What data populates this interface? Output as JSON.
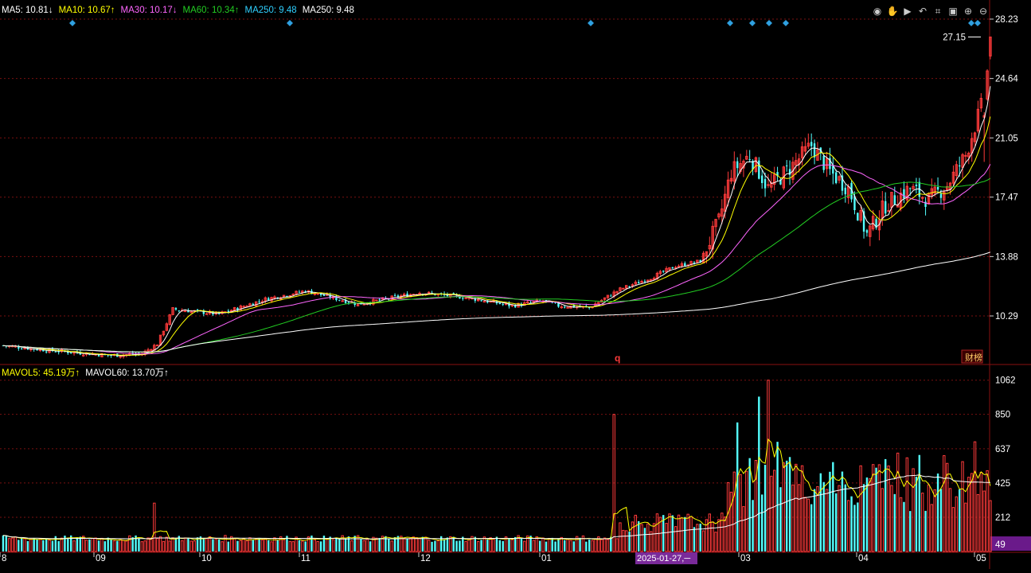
{
  "colors": {
    "up": "#ff3b3b",
    "down": "#54ffff",
    "grid": "#7a1010",
    "axis_text": "#ffffff",
    "ma5": "#ffffff",
    "ma10": "#ffff00",
    "ma30": "#ff66ff",
    "ma60": "#22cc22",
    "ma250": "#ffffff",
    "marker": "#2fa0e0"
  },
  "price_legend": [
    {
      "name": "MA5",
      "value": "10.81",
      "arrow": "↓",
      "color": "#ffffff"
    },
    {
      "name": "MA10",
      "value": "10.67",
      "arrow": "↑",
      "color": "#ffff00"
    },
    {
      "name": "MA30",
      "value": "10.17",
      "arrow": "↓",
      "color": "#ff66ff"
    },
    {
      "name": "MA60",
      "value": "10.34",
      "arrow": "↑",
      "color": "#22cc22"
    },
    {
      "name": "MA250",
      "value": "9.48",
      "arrow": "",
      "color": "#2fd0ff"
    },
    {
      "name": "MA250",
      "value": "9.48",
      "arrow": "",
      "color": "#ffffff"
    }
  ],
  "volume_legend": [
    {
      "name": "MAVOL5",
      "value": "45.19万",
      "arrow": "↑",
      "color": "#ffff00"
    },
    {
      "name": "MAVOL60",
      "value": "13.70万",
      "arrow": "↑",
      "color": "#ffffff"
    }
  ],
  "toolbar": [
    {
      "name": "eye-icon",
      "glyph": "◉"
    },
    {
      "name": "hand-icon",
      "glyph": "✋"
    },
    {
      "name": "play-icon",
      "glyph": "▶"
    },
    {
      "name": "undo-icon",
      "glyph": "↶"
    },
    {
      "name": "crosshair-icon",
      "glyph": "⌗"
    },
    {
      "name": "image-icon",
      "glyph": "▣"
    },
    {
      "name": "zoom-in-icon",
      "glyph": "⊕"
    },
    {
      "name": "zoom-out-icon",
      "glyph": "⊖"
    }
  ],
  "chart_data": [
    {
      "type": "candlestick",
      "price_ticks": [
        "28.23",
        "24.64",
        "21.05",
        "17.47",
        "13.88",
        "10.29"
      ],
      "ylim": [
        7.5,
        29.0
      ],
      "last_price_label": "27.15",
      "event_label": "q",
      "badge_label": "财榜",
      "x_labels": [
        "8",
        "09",
        "10",
        "11",
        "12",
        "01",
        "03",
        "04",
        "05"
      ],
      "date_tooltip": "2025-01-27,─",
      "ma5_last": 10.81,
      "ma10_last": 10.67,
      "ma30_last": 10.17,
      "ma60_last": 10.34,
      "ma250_last": 9.48
    },
    {
      "type": "bar",
      "volume_ticks": [
        "1062",
        "850",
        "637",
        "425",
        "212"
      ],
      "ylim": [
        0,
        1100
      ],
      "last_volume_label": "49",
      "mavol5_last": "45.19万",
      "mavol60_last": "13.70万"
    }
  ]
}
